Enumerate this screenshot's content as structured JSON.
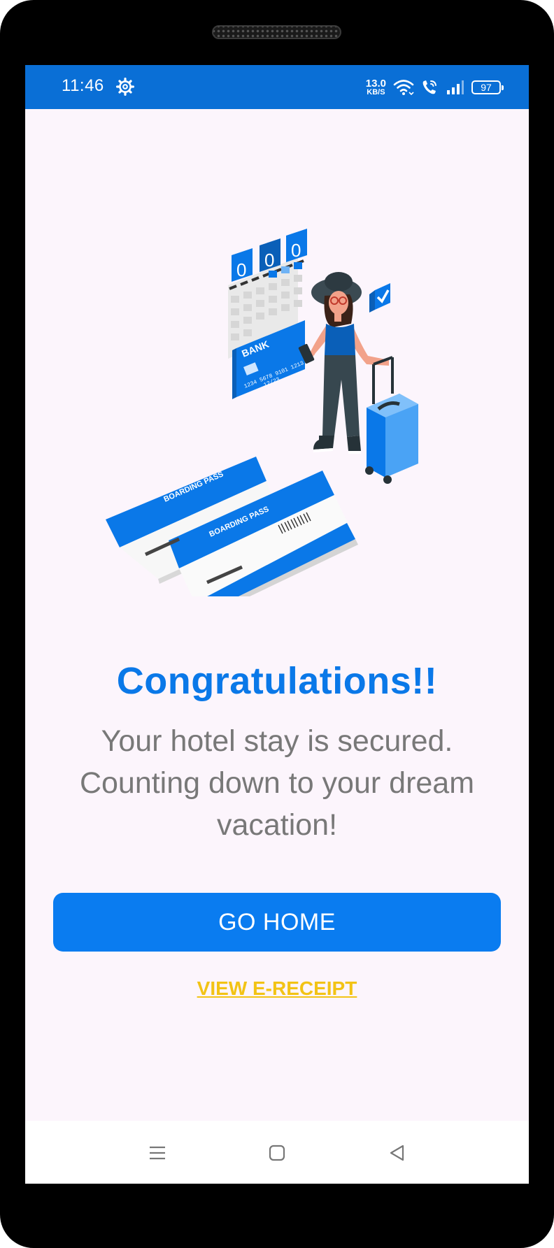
{
  "status_bar": {
    "time": "11:46",
    "net_speed_value": "13.0",
    "net_speed_unit": "KB/S",
    "battery": "97",
    "icons": [
      "gear-icon",
      "wifi-icon",
      "wifi-call-icon",
      "signal-icon",
      "battery-icon"
    ]
  },
  "illustration": {
    "bank_label": "BANK",
    "card_number": "1234 5678 9101 1213",
    "card_expiry": "12/23",
    "boarding_pass_label": "BOARDING PASS"
  },
  "content": {
    "heading": "Congratulations!!",
    "message": "Your hotel stay is secured. Counting down to your dream vacation!",
    "go_home_label": "GO HOME",
    "receipt_link_label": "VIEW E-RECEIPT"
  },
  "nav": {
    "icons": [
      "menu-icon",
      "home-icon",
      "back-icon"
    ]
  },
  "colors": {
    "status_bar": "#0a6fd6",
    "accent": "#0a7cf0",
    "link": "#f2c315",
    "background": "#fcf5fc",
    "message_text": "#787878"
  }
}
